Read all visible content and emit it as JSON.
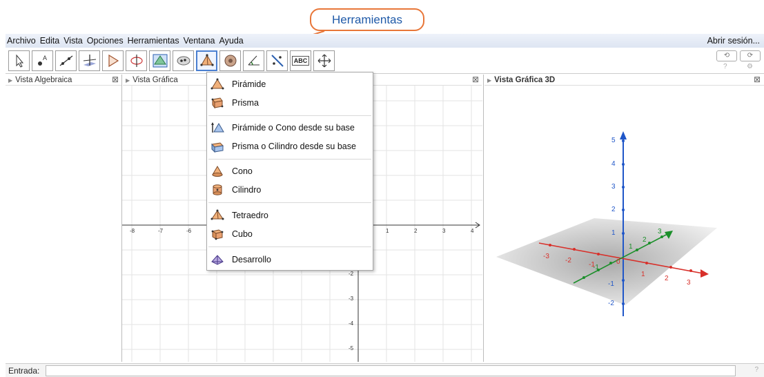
{
  "callout": {
    "label": "Herramientas",
    "color": "#e87638",
    "text_color": "#1f5aa8"
  },
  "menubar": {
    "items": [
      "Archivo",
      "Edita",
      "Vista",
      "Opciones",
      "Herramientas",
      "Ventana",
      "Ayuda"
    ],
    "signin": "Abrir sesión..."
  },
  "toolbar": {
    "tools": [
      "move-tool",
      "point-tool",
      "line-tool",
      "perpendicular-tool",
      "polygon-tool",
      "rotate-tool",
      "plane-tool",
      "sphere-tool",
      "pyramid-tool",
      "cone-tool",
      "angle-tool",
      "reflect-tool",
      "text-tool",
      "view-tool"
    ],
    "active_index": 8,
    "text_tool_label": "ABC"
  },
  "panels": {
    "algebra": "Vista Algebraica",
    "graphics": "Vista Gráfica",
    "graphics3d": "Vista Gráfica 3D"
  },
  "graph2d": {
    "x_ticks": [
      "-8",
      "-7",
      "-6",
      "1",
      "2",
      "3",
      "4"
    ],
    "y_ticks": [
      "-2",
      "-3",
      "-4",
      "-5"
    ]
  },
  "graph3d": {
    "z_ticks": [
      "5",
      "4",
      "3",
      "2",
      "1",
      "-1",
      "-2"
    ],
    "x_ticks": [
      "-3",
      "-2",
      "-1",
      "0",
      "1",
      "2",
      "3"
    ],
    "y_ticks": [
      "-1",
      "1",
      "2",
      "3"
    ],
    "colors": {
      "x_axis": "#d8302a",
      "y_axis": "#1b8f2a",
      "z_axis": "#1f56c8",
      "plane": "#8a8a8a"
    }
  },
  "dropdown": {
    "items": [
      {
        "label": "Pirámide",
        "icon": "pyramid-icon"
      },
      {
        "label": "Prisma",
        "icon": "prism-icon"
      },
      {
        "label": "Pirámide o Cono desde su base",
        "icon": "extrude-pyramid-icon"
      },
      {
        "label": "Prisma o Cilindro desde su base",
        "icon": "extrude-prism-icon"
      },
      {
        "label": "Cono",
        "icon": "cone-icon"
      },
      {
        "label": "Cilindro",
        "icon": "cylinder-icon"
      },
      {
        "label": "Tetraedro",
        "icon": "tetrahedron-icon"
      },
      {
        "label": "Cubo",
        "icon": "cube-icon"
      },
      {
        "label": "Desarrollo",
        "icon": "net-icon"
      }
    ]
  },
  "inputbar": {
    "label": "Entrada:"
  }
}
